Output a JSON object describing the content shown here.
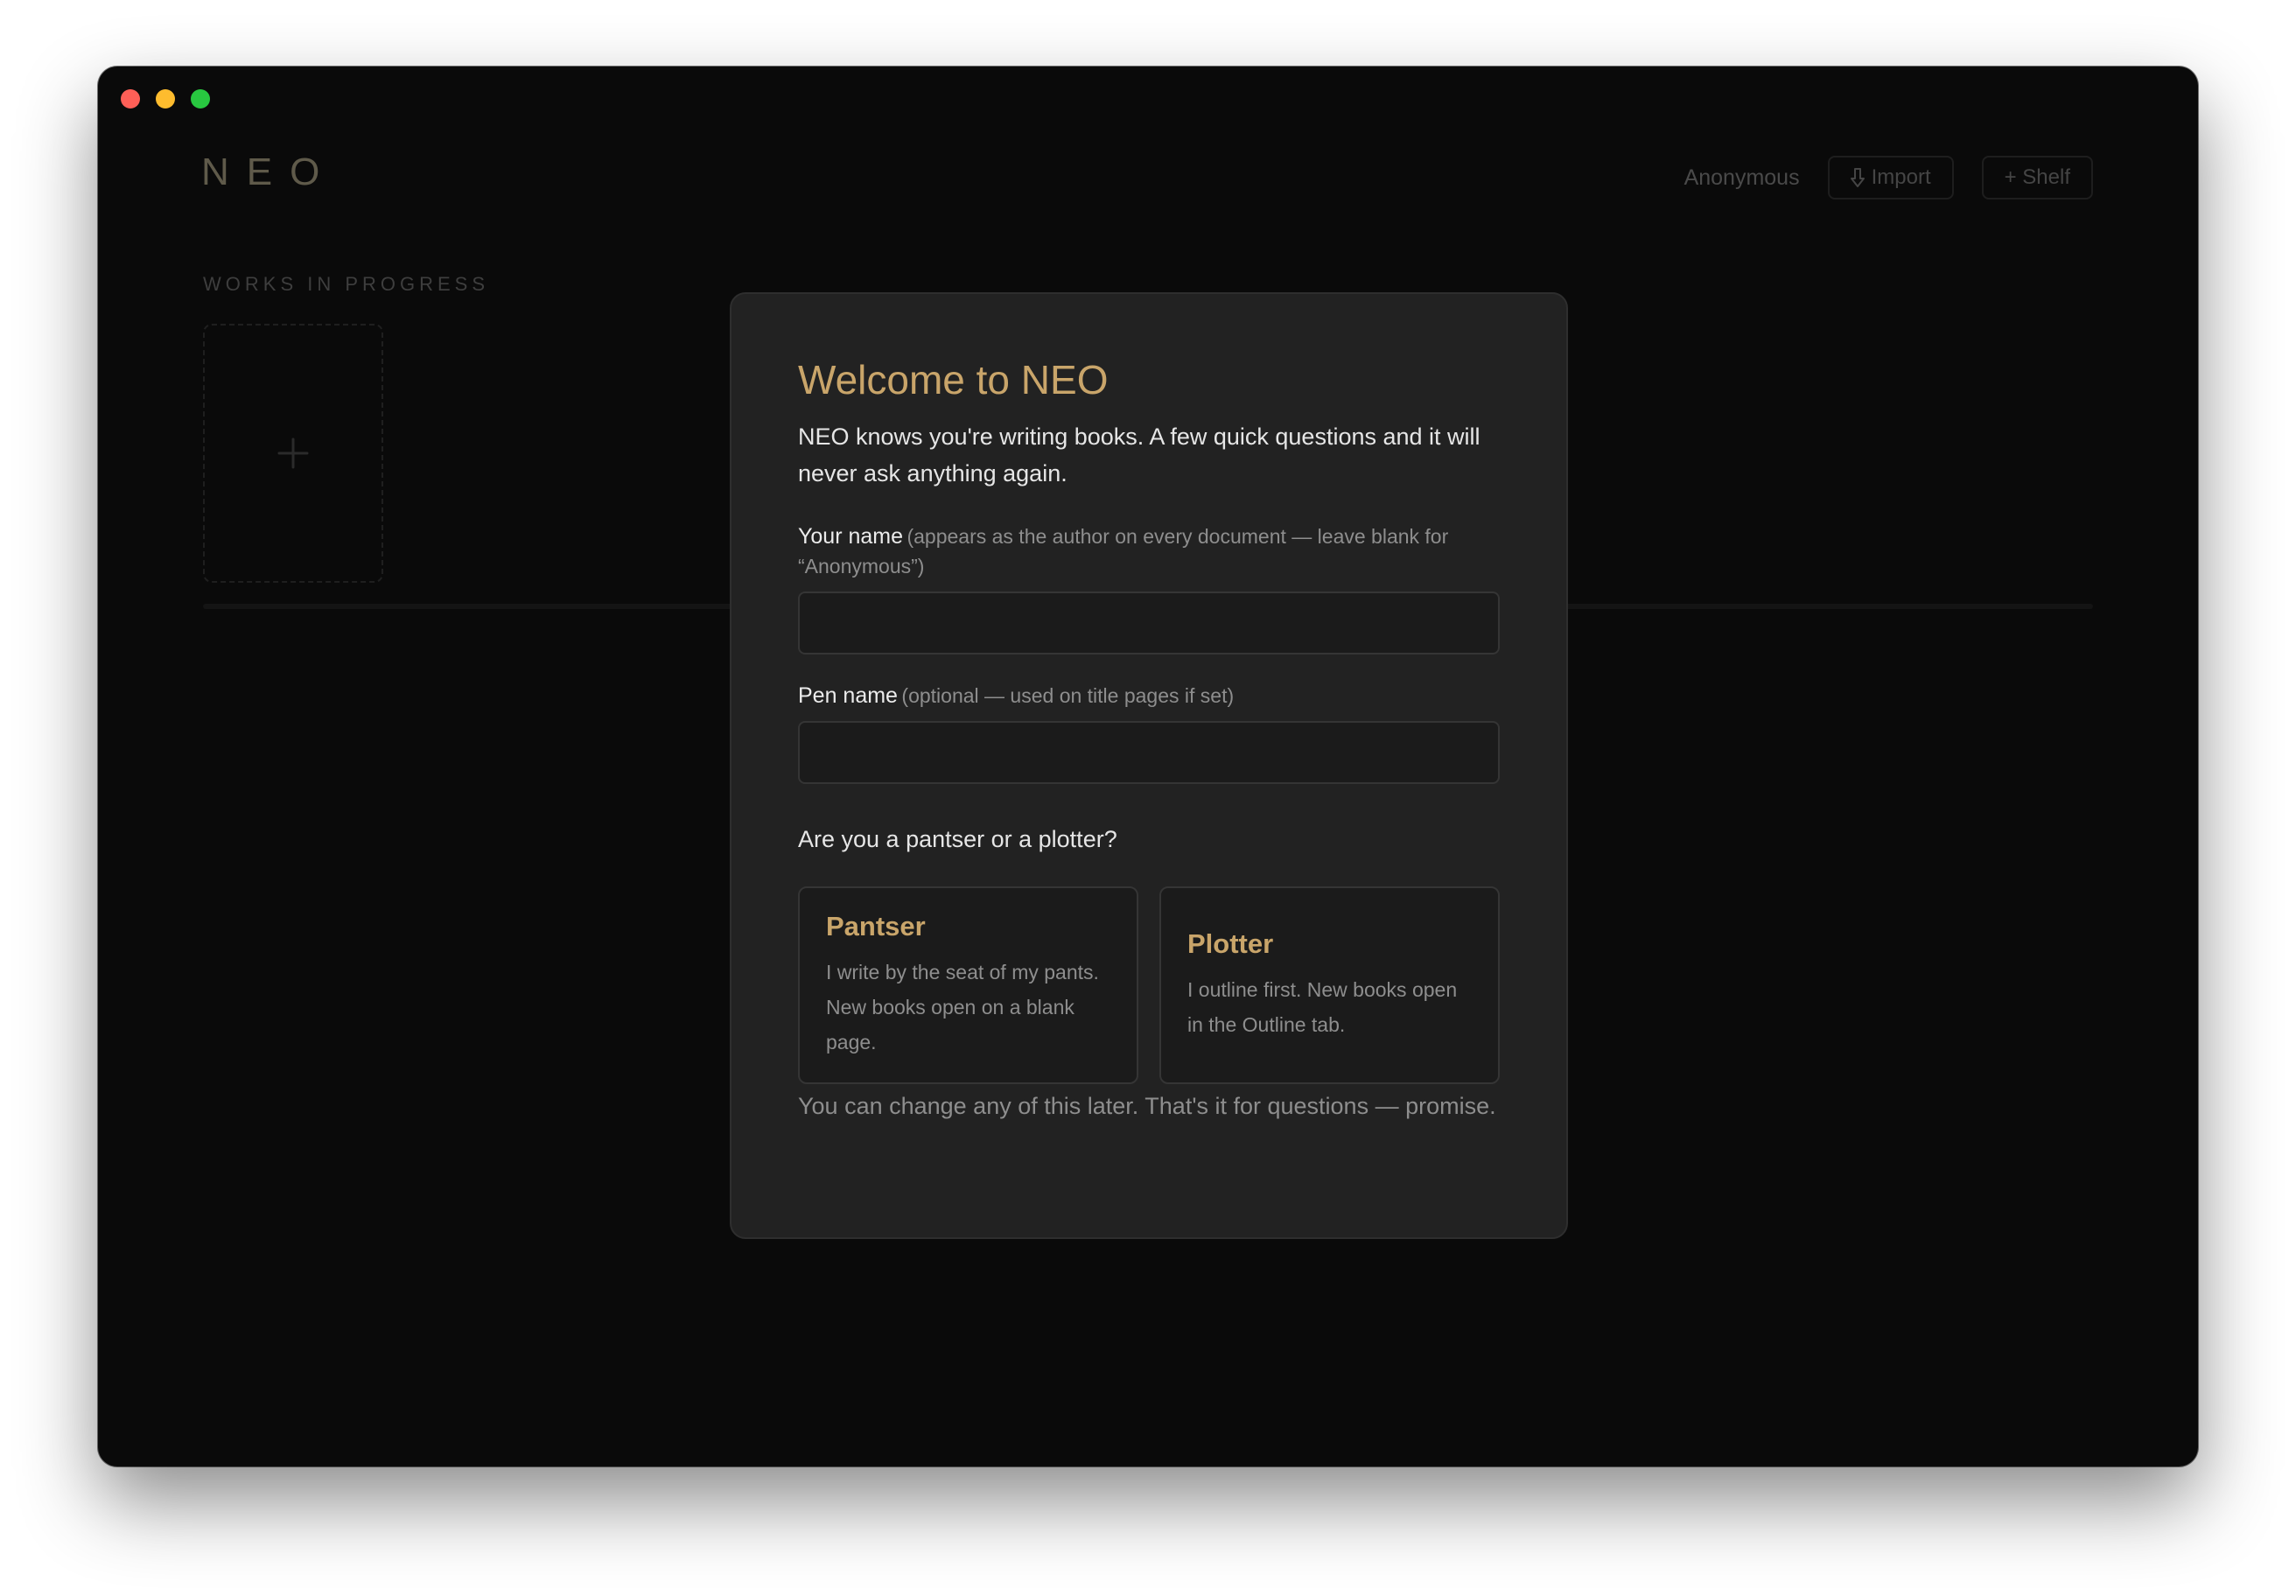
{
  "app": {
    "brand": "NEO",
    "user_label": "Anonymous",
    "import_label": "Import",
    "shelf_label": "+ Shelf",
    "section_label": "WORKS IN PROGRESS"
  },
  "modal": {
    "title": "Welcome to NEO",
    "intro": "NEO knows you're writing books. A few quick questions and it will never ask anything again.",
    "name_field": {
      "label": "Your name",
      "hint": "(appears as the author on every document — leave blank for “Anonymous”)",
      "value": ""
    },
    "pen_field": {
      "label": "Pen name",
      "hint": "(optional — used on title pages if set)",
      "value": ""
    },
    "question": "Are you a pantser or a plotter?",
    "choices": [
      {
        "title": "Pantser",
        "description": "I write by the seat of my pants. New books open on a blank page."
      },
      {
        "title": "Plotter",
        "description": "I outline first. New books open in the Outline tab."
      }
    ],
    "footnote": "You can change any of this later. That's it for questions — promise."
  },
  "colors": {
    "accent": "#c9a56a",
    "window_bg": "#0a0a0a",
    "modal_bg": "#222222",
    "traffic_close": "#fe5f57",
    "traffic_minimize": "#febc2e",
    "traffic_zoom": "#28c840"
  },
  "icons": {
    "import": "download-arrow-icon",
    "new_book": "plus-icon"
  }
}
